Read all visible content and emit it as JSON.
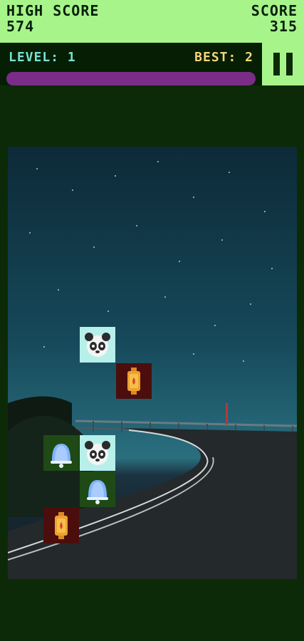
{
  "hud": {
    "high_score_label": "HIGH SCORE",
    "high_score_value": "574",
    "score_label": "SCORE",
    "score_value": "315",
    "level_text": "LEVEL: 1",
    "best_text": "BEST: 2",
    "progress_fraction": 0.0
  },
  "colors": {
    "top_bar": "#a7f58a",
    "background": "#0c2a08",
    "level_text": "#7be0d2",
    "best_text": "#f5d47a",
    "progress": "#7a2d86",
    "panda_tile": "#b7f0ea",
    "bell_tile": "#1f4a16",
    "lantern_tile": "#4b0e0d"
  },
  "board": {
    "background_scene": "night sky road",
    "tiles": [
      {
        "icon": "panda-icon",
        "kind": "panda"
      },
      {
        "icon": "lantern-icon",
        "kind": "lantern"
      },
      {
        "icon": "bell-icon",
        "kind": "bell"
      },
      {
        "icon": "panda-icon",
        "kind": "panda"
      },
      {
        "icon": "bell-icon",
        "kind": "bell"
      },
      {
        "icon": "lantern-icon",
        "kind": "lantern"
      }
    ]
  },
  "icons": {
    "pause": "pause-icon"
  }
}
